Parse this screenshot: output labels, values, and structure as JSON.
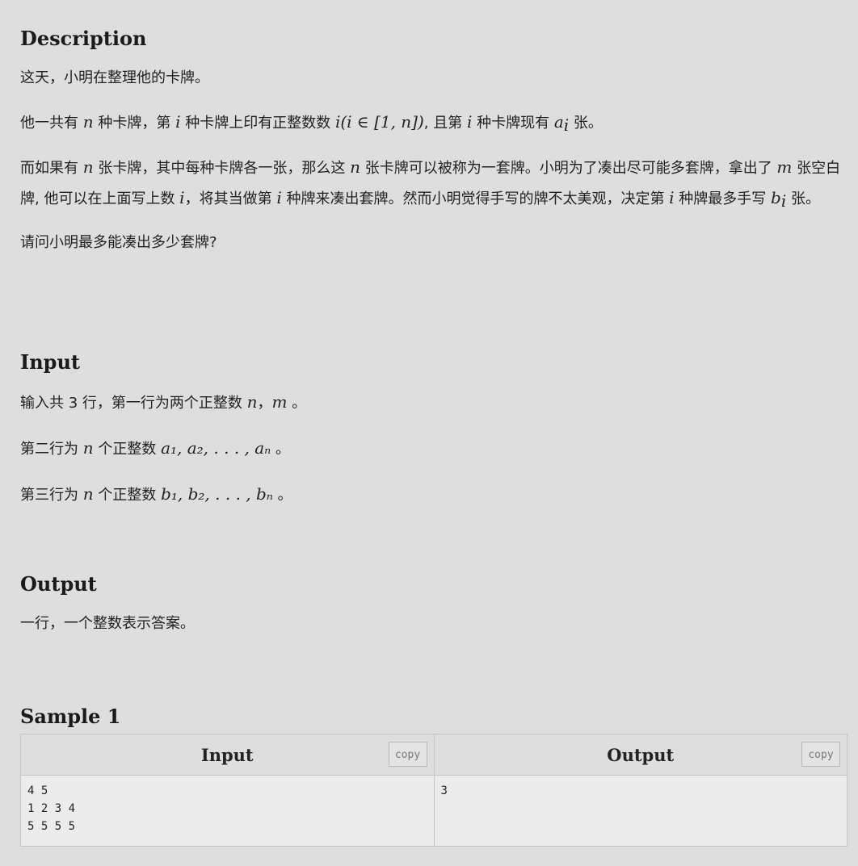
{
  "description": {
    "heading": "Description",
    "p1": "这天，小明在整理他的卡牌。",
    "p2": {
      "t1": "他一共有 ",
      "n": "n",
      "t2": " 种卡牌，第 ",
      "i1": "i",
      "t3": " 种卡牌上印有正整数数 ",
      "i2": "i",
      "expr": "(i ∈ [1, n])",
      "t4": ", 且第 ",
      "i3": "i",
      "t5": " 种卡牌现有 ",
      "a": "a",
      "asub": "i",
      "t6": " 张。"
    },
    "p3": {
      "t1": "而如果有 ",
      "n1": "n",
      "t2": " 张卡牌，其中每种卡牌各一张，那么这 ",
      "n2": "n",
      "t3": " 张卡牌可以被称为一套牌。小明为了凑出尽可能多套牌，拿出了 ",
      "m": "m",
      "t4": " 张空白牌, 他可以在上面写上数 ",
      "i1": "i",
      "t5": "，将其当做第 ",
      "i2": "i",
      "t6": " 种牌来凑出套牌。然而小明觉得手写的牌不太美观，决定第 ",
      "i3": "i",
      "t7": " 种牌最多手写 ",
      "b": "b",
      "bsub": "i",
      "t8": " 张。"
    },
    "p4": "请问小明最多能凑出多少套牌?"
  },
  "input": {
    "heading": "Input",
    "l1": {
      "t1": "输入共 3 行，第一行为两个正整数 ",
      "n": "n",
      "sep": "，",
      "m": "m",
      "t2": " 。"
    },
    "l2": {
      "t1": "第二行为 ",
      "n": "n",
      "t2": " 个正整数 ",
      "expr": "a₁, a₂, . . . , aₙ",
      "t3": " 。"
    },
    "l3": {
      "t1": "第三行为 ",
      "n": "n",
      "t2": " 个正整数 ",
      "expr": "b₁, b₂, . . . , bₙ",
      "t3": " 。"
    }
  },
  "output": {
    "heading": "Output",
    "p1": "一行，一个整数表示答案。"
  },
  "sample": {
    "heading": "Sample 1",
    "input_header": "Input",
    "output_header": "Output",
    "copy_label": "copy",
    "input_text": "4 5\n1 2 3 4\n5 5 5 5",
    "output_text": "3"
  }
}
